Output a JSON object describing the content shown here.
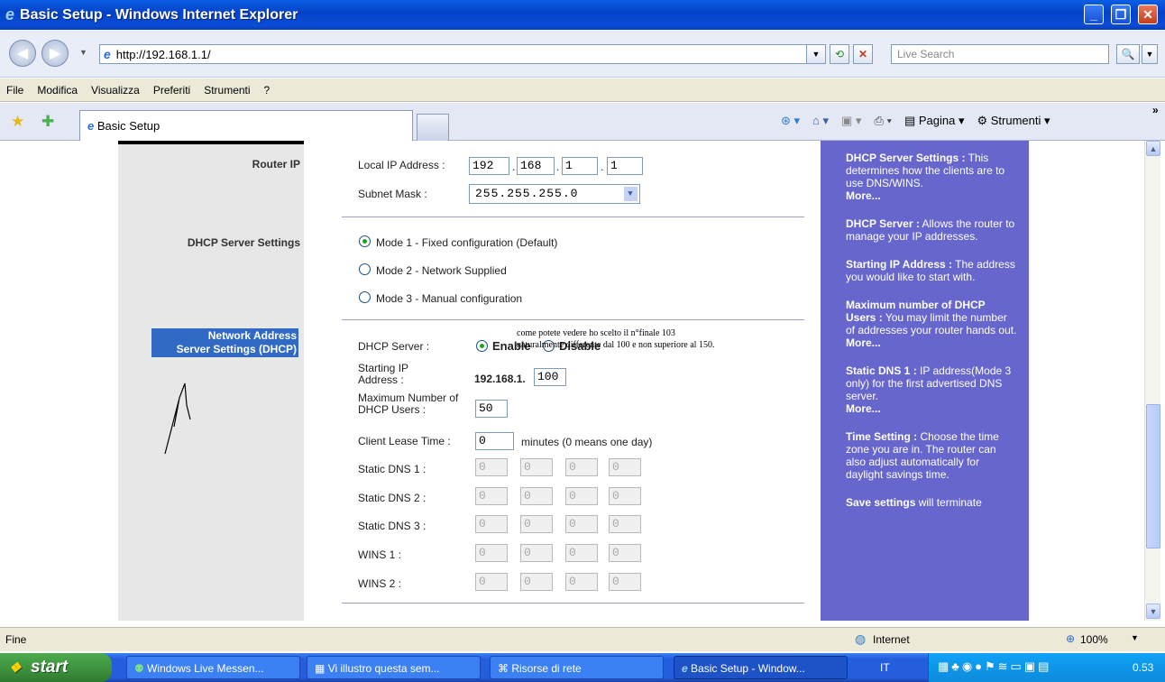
{
  "window": {
    "title": "Basic Setup - Windows Internet Explorer"
  },
  "address_bar": {
    "url": "http://192.168.1.1/",
    "search_placeholder": "Live Search"
  },
  "menu": [
    "File",
    "Modifica",
    "Visualizza",
    "Preferiti",
    "Strumenti",
    "?"
  ],
  "favorites_bar": {
    "tab_label": "Basic Setup",
    "pagina": "Pagina",
    "strumenti": "Strumenti"
  },
  "sections": {
    "router_ip": "Router IP",
    "dhcp_server_settings": "DHCP Server Settings",
    "network_address_line1": "Network Address",
    "network_address_line2": "Server Settings (DHCP)"
  },
  "router_ip": {
    "local_ip_label": "Local IP Address :",
    "ip_octets": [
      "192",
      "168",
      "1",
      "1"
    ],
    "subnet_label": "Subnet Mask :",
    "subnet_value": "255.255.255.0"
  },
  "dhcp_modes": [
    {
      "label": "Mode 1 - Fixed configuration (Default)",
      "selected": true
    },
    {
      "label": "Mode 2 - Network Supplied",
      "selected": false
    },
    {
      "label": "Mode 3 - Manual configuration",
      "selected": false
    }
  ],
  "dhcp": {
    "server_label": "DHCP Server :",
    "enable": "Enable",
    "disable": "Disable",
    "starting_ip_label": "Starting IP Address :",
    "starting_ip_prefix": "192.168.1.",
    "starting_ip_last": "100",
    "max_users_label": "Maximum Number of DHCP Users :",
    "max_users": "50",
    "lease_label": "Client Lease Time :",
    "lease_value": "0",
    "lease_hint": "minutes (0 means one day)",
    "static_dns_1": "Static DNS 1 :",
    "static_dns_2": "Static DNS 2 :",
    "static_dns_3": "Static DNS 3 :",
    "wins_1": "WINS 1 :",
    "wins_2": "WINS 2 :",
    "disabled_octet": "0"
  },
  "annotation": "come potete vedere ho scelto il n°finale 103 naturalmente differente dal 100 e non superiore al 150.",
  "help": [
    {
      "title": "DHCP Server Settings :",
      "text": "This determines how the clients are to use DNS/WINS.",
      "more": "More..."
    },
    {
      "title": "DHCP Server :",
      "text": "Allows the router to manage your IP addresses.",
      "more": ""
    },
    {
      "title": "Starting IP Address :",
      "text": "The address you would like to start with.",
      "more": ""
    },
    {
      "title": "Maximum number of DHCP Users :",
      "text": "You may limit the number of addresses your router hands out.",
      "more": "More..."
    },
    {
      "title": "Static DNS 1 :",
      "text": "IP address(Mode 3 only) for the first advertised DNS server.",
      "more": "More..."
    },
    {
      "title": "Time Setting :",
      "text": "Choose the time zone you are in. The router can also adjust automatically for daylight savings time.",
      "more": ""
    },
    {
      "title": "Save settings",
      "text": "will terminate",
      "more": ""
    }
  ],
  "status": {
    "text": "Fine",
    "zone": "Internet",
    "zoom": "100%"
  },
  "taskbar": {
    "start": "start",
    "buttons": [
      "Windows Live Messen...",
      "Vi illustro questa sem...",
      "Risorse di rete",
      "Basic Setup - Window..."
    ],
    "lang": "IT",
    "clock": "0.53"
  }
}
